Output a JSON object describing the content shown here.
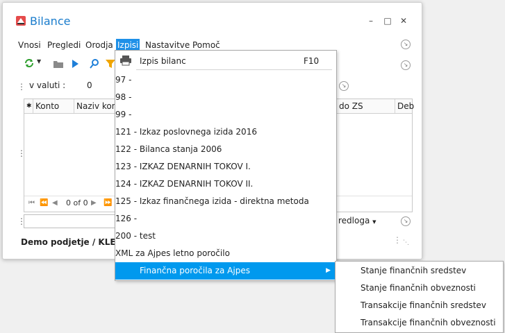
{
  "window": {
    "title": "Bilance",
    "controls": [
      "–",
      "□",
      "✕"
    ]
  },
  "menubar": {
    "items": [
      "Vnosi",
      "Pregledi",
      "Orodja",
      "Izpisi",
      "Nastavitve",
      "Pomoč"
    ],
    "active": "Izpisi"
  },
  "toolbar": {
    "icons": [
      "refresh-icon",
      "folder-icon",
      "play-icon",
      "search-icon",
      "filter-icon"
    ]
  },
  "filter": {
    "currency_label": "v valuti :",
    "currency_value": "0"
  },
  "grid": {
    "columns": [
      "✱",
      "Konto",
      "Naziv konta",
      "do ZS",
      "Deb"
    ],
    "pager_text": "0 of 0"
  },
  "bottom": {
    "predloga_label": "redloga",
    "status": "Demo podjetje / KLEMEN"
  },
  "izpisi_menu": {
    "items": [
      {
        "label": "Izpis bilanc",
        "shortcut": "F10"
      },
      {
        "label": "97 -"
      },
      {
        "label": "98 -"
      },
      {
        "label": "99 -"
      },
      {
        "label": "121 - Izkaz poslovnega izida 2016"
      },
      {
        "label": "122 - Bilanca stanja 2006"
      },
      {
        "label": "123 - IZKAZ DENARNIH TOKOV I."
      },
      {
        "label": "124 - IZKAZ DENARNIH TOKOV II."
      },
      {
        "label": "125 - Izkaz finančnega izida - direktna metoda"
      },
      {
        "label": "126 -"
      },
      {
        "label": "200 - test"
      },
      {
        "label": "XML za Ajpes letno poročilo"
      },
      {
        "label": "Finančna poročila za Ajpes"
      }
    ],
    "highlighted_index": 12
  },
  "submenu": {
    "items": [
      "Stanje finančnih sredstev",
      "Stanje finančnih obveznosti",
      "Transakcije finančnih sredstev",
      "Transakcije finančnih obveznosti"
    ]
  },
  "colors": {
    "accent": "#0099ee",
    "title": "#1a7ccc",
    "menu_active": "#1e90e8"
  }
}
